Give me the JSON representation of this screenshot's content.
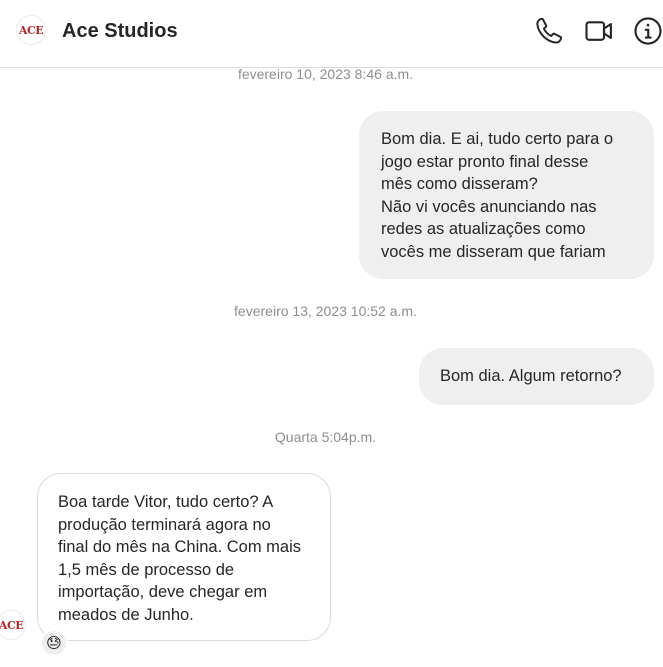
{
  "header": {
    "avatar_text": "ACE",
    "title": "Ace Studios",
    "icons": [
      "phone-icon",
      "video-camera-icon",
      "info-icon"
    ]
  },
  "messages": [
    {
      "type": "timestamp",
      "text": "fevereiro 10, 2023 8:46 a.m."
    },
    {
      "type": "outgoing",
      "text": "Bom dia. E ai, tudo certo para o\njogo estar pronto final desse\nmês como disseram?\nNão vi vocês anunciando nas\nredes as atualizações como\nvocês me disseram que fariam"
    },
    {
      "type": "timestamp",
      "text": "fevereiro 13, 2023 10:52 a.m."
    },
    {
      "type": "outgoing",
      "text": "Bom dia. Algum retorno?"
    },
    {
      "type": "timestamp",
      "text": "Quarta 5:04p.m."
    },
    {
      "type": "incoming",
      "sender_avatar": "ACE",
      "text": "Boa tarde Vitor, tudo certo? A\nprodução terminará agora no\nfinal do mês na China. Com mais\n1,5 mês de processo de\nimportação, deve chegar em\nmeados de Junho.",
      "reaction": "😓"
    }
  ]
}
